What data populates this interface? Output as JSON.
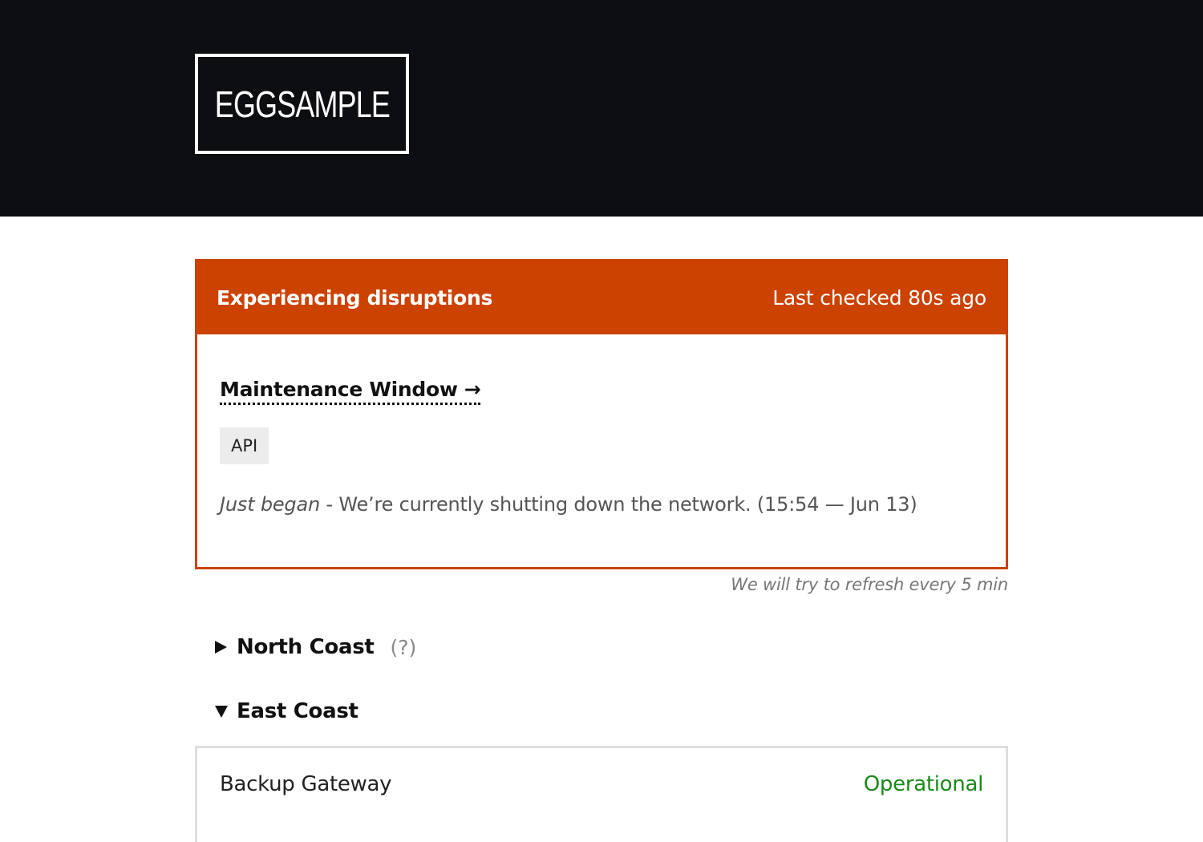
{
  "header": {
    "logo_text": "EGGSAMPLE"
  },
  "status": {
    "title": "Experiencing disruptions",
    "last_checked": "Last checked 80s ago",
    "accent_color": "#cc4200",
    "incident": {
      "title": "Maintenance Window",
      "arrow": "→",
      "affected_tag": "API",
      "phase": "Just began",
      "separator": " - ",
      "message": "We’re currently shutting down the network.",
      "time": "(15:54 — Jun 13)"
    }
  },
  "refresh_note": "We will try to refresh every 5 min",
  "regions": [
    {
      "name": "North Coast",
      "help": "(?)",
      "expanded": false
    },
    {
      "name": "East Coast",
      "expanded": true,
      "components": [
        {
          "name": "Backup Gateway",
          "status": "Operational",
          "status_color": "#1a8a1a"
        }
      ]
    }
  ]
}
